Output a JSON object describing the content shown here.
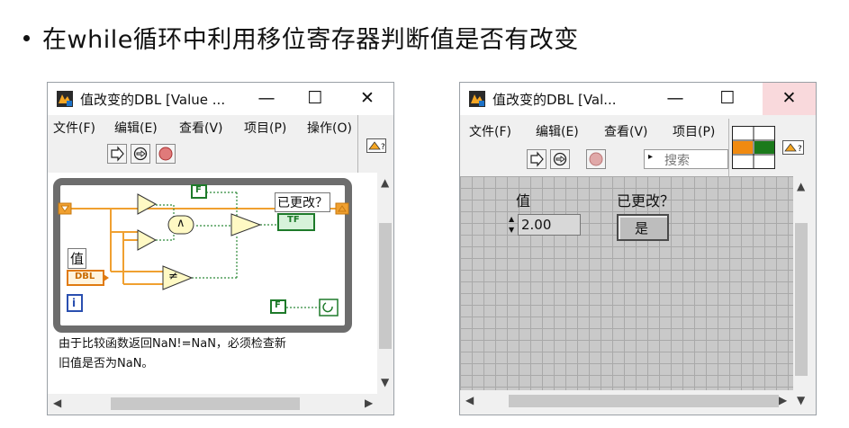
{
  "slide": {
    "title": "在while循环中利用移位寄存器判断值是否有改变"
  },
  "block_diagram_window": {
    "title": "值改变的DBL [Value ...",
    "controls": {
      "minimize": "—",
      "maximize": "☐",
      "close": "✕"
    },
    "menu": [
      "文件(F)",
      "编辑(E)",
      "查看(V)",
      "项目(P)",
      "操作(O)"
    ],
    "diagram": {
      "changed_label": "已更改？",
      "value_label": "值",
      "dbl_terminal": "DBL",
      "tf_terminal": "TF",
      "bool_false": "F",
      "iteration": "i",
      "and_symbol": "∧",
      "not_equal_symbol": "≠"
    },
    "note_lines": [
      "由于比较函数返回NaN!=NaN，必须检查新",
      "旧值是否为NaN。"
    ]
  },
  "front_panel_window": {
    "title": "值改变的DBL [Val...",
    "controls": {
      "minimize": "—",
      "maximize": "☐",
      "close": "✕"
    },
    "menu": [
      "文件(F)",
      "编辑(E)",
      "查看(V)",
      "项目(P)"
    ],
    "search_placeholder": "搜索",
    "value_label": "值",
    "value": "2.00",
    "changed_label": "已更改？",
    "changed_indicator": "是"
  }
}
